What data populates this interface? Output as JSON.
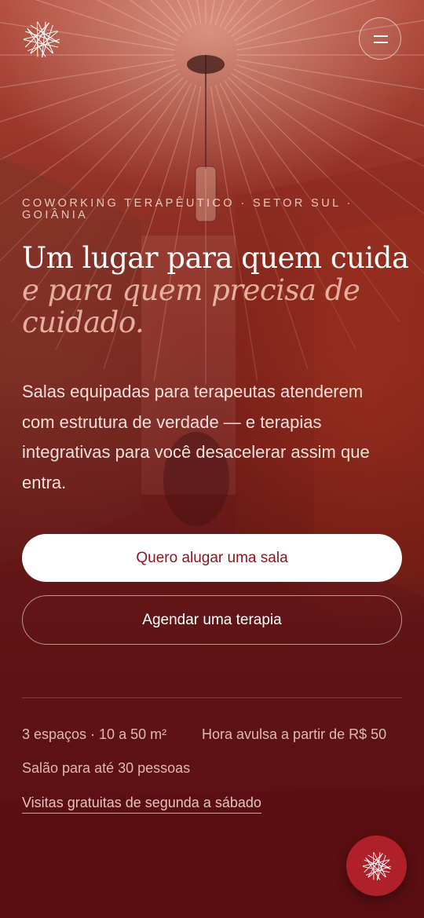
{
  "header": {
    "logo_icon": "starburst-logo-icon",
    "menu_icon": "hamburger-menu-icon"
  },
  "hero": {
    "eyebrow": "COWORKING TERAPÊUTICO · SETOR SUL · GOIÂNIA",
    "title_line1": "Um lugar para quem cuida",
    "title_line2": "e para quem precisa de cuidado.",
    "lead": "Salas equipadas para terapeutas atenderem com estrutura de verdade — e terapias integrativas para você desacelerar assim que entra.",
    "primary_cta": "Quero alugar uma sala",
    "secondary_cta": "Agendar uma terapia"
  },
  "facts": {
    "spaces": "3 espaços · 10 a 50 m²",
    "hourly": "Hora avulsa a partir de R$ 50",
    "hall": "Salão para até 30 pessoas",
    "visits_link": "Visitas gratuitas de segunda a sábado"
  },
  "fab": {
    "icon": "starburst-chat-icon"
  },
  "colors": {
    "brand_red": "#b0202a",
    "primary_cta_text": "#8b1620"
  }
}
